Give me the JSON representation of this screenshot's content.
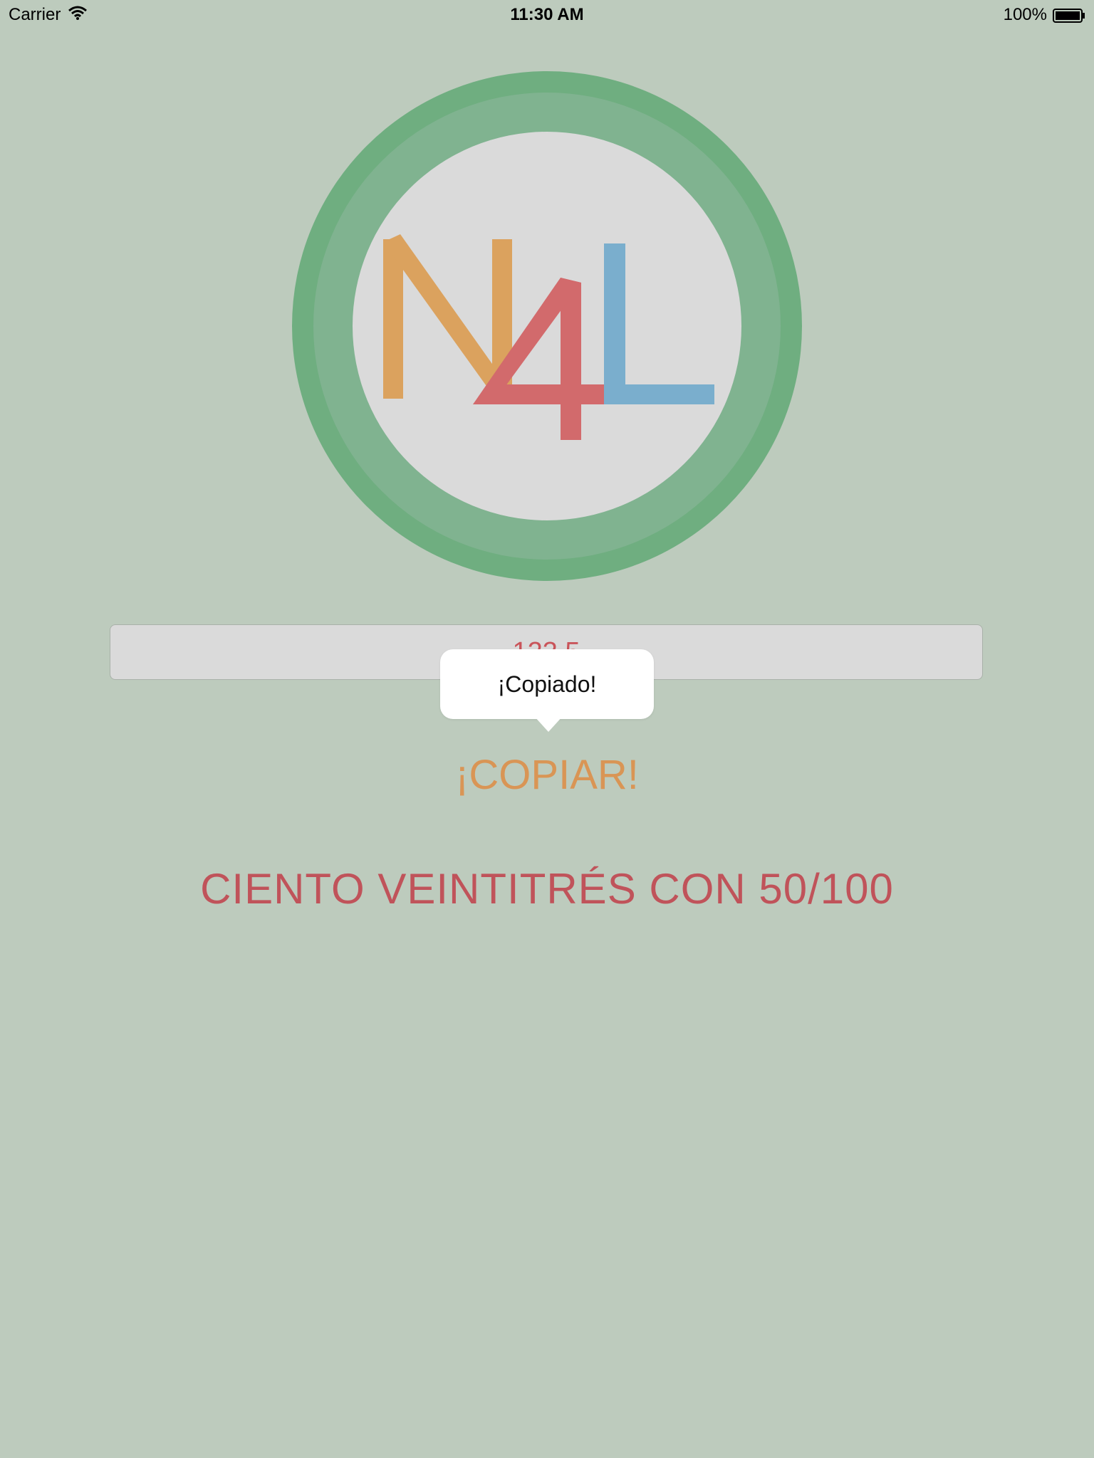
{
  "status_bar": {
    "carrier": "Carrier",
    "time": "11:30 AM",
    "battery": "100%"
  },
  "logo": {
    "letters": [
      "N",
      "4",
      "L"
    ],
    "colors": {
      "outer_ring": "#6fae80",
      "inner_ring": "#80b390",
      "face": "#dadada",
      "n": "#dba25e",
      "four": "#d26a6c",
      "l": "#7aaecd"
    }
  },
  "input": {
    "value": "123.5"
  },
  "tooltip": {
    "text": "¡Copiado!"
  },
  "copy_button": {
    "label": "¡COPIAR!"
  },
  "result": {
    "text": "CIENTO VEINTITRÉS CON 50/100"
  },
  "colors": {
    "background": "#bdcbbd",
    "accent_orange": "#d99555",
    "accent_red": "#c0535a"
  }
}
